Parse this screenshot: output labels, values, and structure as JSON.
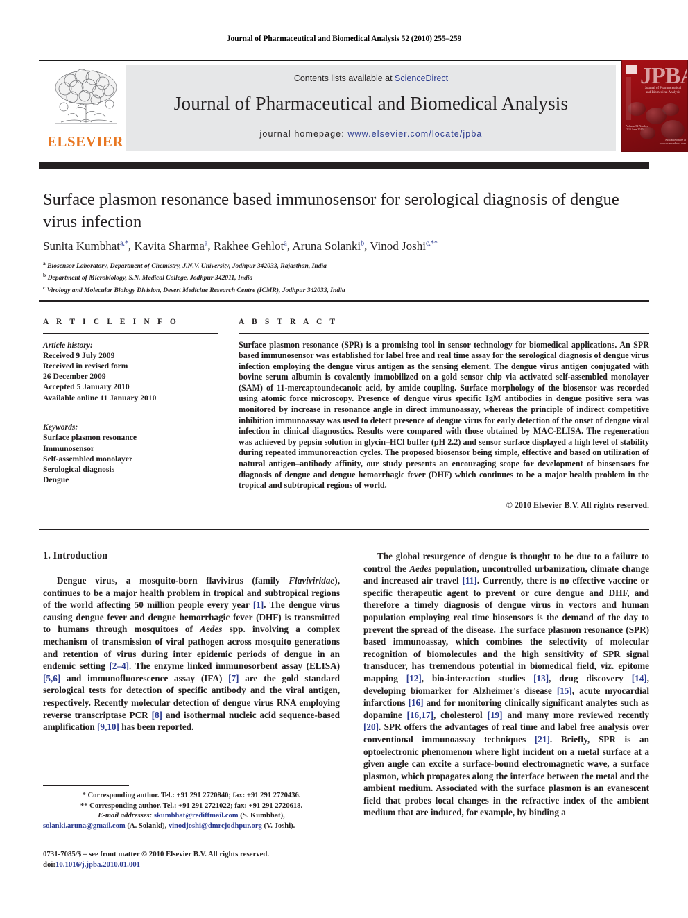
{
  "running_head": "Journal of Pharmaceutical and Biomedical Analysis 52 (2010) 255–259",
  "masthead": {
    "contents_text": "Contents lists available at ",
    "sciencedirect": "ScienceDirect",
    "journal_title": "Journal of Pharmaceutical and Biomedical Analysis",
    "homepage_label": "journal homepage: ",
    "homepage_url": "www.elsevier.com/locate/jpba",
    "publisher_wordmark": "ELSEVIER",
    "publisher_color": "#e87722",
    "link_color": "#2b3a8f",
    "banner_bg": "#e6e7e8",
    "cover": {
      "acronym": "JPBA",
      "subtitle": "Journal of Pharmaceutical and Biomedical Analysis",
      "bg_color": "#a81016",
      "footer_left": "Volume 52 Number 2 15 June 2010",
      "footer_right": "Available online at www.sciencedirect.com"
    }
  },
  "article": {
    "title": "Surface plasmon resonance based immunosensor for serological diagnosis of dengue virus infection",
    "authors": "Sunita Kumbhat<sup>a,</sup><sup>*</sup>, Kavita Sharma<sup>a</sup>, Rakhee Gehlot<sup>a</sup>, Aruna Solanki<sup>b</sup>, Vinod Joshi<sup>c,</sup><sup>**</sup>",
    "affiliations": [
      "<sup>a</sup> Biosensor Laboratory, Department of Chemistry, J.N.V. University, Jodhpur 342033, Rajasthan, India",
      "<sup>b</sup> Department of Microbiology, S.N. Medical College, Jodhpur 342011, India",
      "<sup>c</sup> Virology and Molecular Biology Division, Desert Medicine Research Centre (ICMR), Jodhpur 342033, India"
    ]
  },
  "article_info": {
    "heading": "A R T I C L E   I N F O",
    "history_label": "Article history:",
    "history": [
      "Received 9 July 2009",
      "Received in revised form",
      "26 December 2009",
      "Accepted 5 January 2010",
      "Available online 11 January 2010"
    ],
    "keywords_label": "Keywords:",
    "keywords": [
      "Surface plasmon resonance",
      "Immunosensor",
      "Self-assembled monolayer",
      "Serological diagnosis",
      "Dengue"
    ]
  },
  "abstract": {
    "heading": "A B S T R A C T",
    "text": "Surface plasmon resonance (SPR) is a promising tool in sensor technology for biomedical applications. An SPR based immunosensor was established for label free and real time assay for the serological diagnosis of dengue virus infection employing the dengue virus antigen as the sensing element. The dengue virus antigen conjugated with bovine serum albumin is covalently immobilized on a gold sensor chip via activated self-assembled monolayer (SAM) of 11-mercaptoundecanoic acid, by amide coupling. Surface morphology of the biosensor was recorded using atomic force microscopy. Presence of dengue virus specific IgM antibodies in dengue positive sera was monitored by increase in resonance angle in direct immunoassay, whereas the principle of indirect competitive inhibition immunoassay was used to detect presence of dengue virus for early detection of the onset of dengue viral infection in clinical diagnostics. Results were compared with those obtained by MAC-ELISA. The regeneration was achieved by pepsin solution in glycin–HCl buffer (pH 2.2) and sensor surface displayed a high level of stability during repeated immunoreaction cycles. The proposed biosensor being simple, effective and based on utilization of natural antigen–antibody affinity, our study presents an encouraging scope for development of biosensors for diagnosis of dengue and dengue hemorrhagic fever (DHF) which continues to be a major health problem in the tropical and subtropical regions of world.",
    "copyright": "© 2010 Elsevier B.V. All rights reserved."
  },
  "body": {
    "section_heading": "1.  Introduction",
    "left_paragraphs": [
      "Dengue virus, a mosquito-born flavivirus (family <em>Flaviviridae</em>), continues to be a major health problem in tropical and subtropical regions of the world affecting 50 million people every year <span class=\"ref\">[1]</span>. The dengue virus causing dengue fever and dengue hemorrhagic fever (DHF) is transmitted to humans through mosquitoes of <em>Aedes</em> spp. involving a complex mechanism of transmission of viral pathogen across mosquito generations and retention of virus during inter epidemic periods of dengue in an endemic setting <span class=\"ref\">[2–4]</span>. The enzyme linked immunosorbent assay (ELISA) <span class=\"ref\">[5,6]</span> and immunofluorescence assay (IFA) <span class=\"ref\">[7]</span> are the gold standard serological tests for detection of specific antibody and the viral antigen, respectively. Recently molecular detection of dengue virus RNA employing reverse transcriptase PCR <span class=\"ref\">[8]</span> and isothermal nucleic acid sequence-based amplification <span class=\"ref\">[9,10]</span> has been reported."
    ],
    "right_paragraphs": [
      "The global resurgence of dengue is thought to be due to a failure to control the <em>Aedes</em> population, uncontrolled urbanization, climate change and increased air travel <span class=\"ref\">[11]</span>. Currently, there is no effective vaccine or specific therapeutic agent to prevent or cure dengue and DHF, and therefore a timely diagnosis of dengue virus in vectors and human population employing real time biosensors is the demand of the day to prevent the spread of the disease. The surface plasmon resonance (SPR) based immunoassay, which combines the selectivity of molecular recognition of biomolecules and the high sensitivity of SPR signal transducer, has tremendous potential in biomedical field, viz. epitome mapping <span class=\"ref\">[12]</span>, bio-interaction studies <span class=\"ref\">[13]</span>, drug discovery <span class=\"ref\">[14]</span>, developing biomarker for Alzheimer's disease <span class=\"ref\">[15]</span>, acute myocardial infarctions <span class=\"ref\">[16]</span> and for monitoring clinically significant analytes such as dopamine <span class=\"ref\">[16,17]</span>, cholesterol <span class=\"ref\">[19]</span> and many more reviewed recently <span class=\"ref\">[20]</span>. SPR offers the advantages of real time and label free analysis over conventional immunoassay techniques <span class=\"ref\">[21]</span>. Briefly, SPR is an optoelectronic phenomenon where light incident on a metal surface at a given angle can excite a surface-bound electromagnetic wave, a surface plasmon, which propagates along the interface between the metal and the ambient medium. Associated with the surface plasmon is an evanescent field that probes local changes in the refractive index of the ambient medium that are induced, for example, by binding a"
    ]
  },
  "footnotes": {
    "corresponding_1": "* Corresponding author. Tel.: +91 291 2720840; fax: +91 291 2720436.",
    "corresponding_2": "** Corresponding author. Tel.: +91 291 2721022; fax: +91 291 2720618.",
    "email_label": "E-mail addresses:",
    "email_1": "skumbhat@rediffmail.com",
    "email_1_owner": "(S. Kumbhat),",
    "email_2": "solanki.aruna@gmail.com",
    "email_2_owner": "(A. Solanki),",
    "email_3": "vinodjoshi@dmrcjodhpur.org",
    "email_3_owner": "(V. Joshi)."
  },
  "imprint": {
    "line1": "0731-7085/$ – see front matter © 2010 Elsevier B.V. All rights reserved.",
    "doi_label": "doi:",
    "doi_value": "10.1016/j.jpba.2010.01.001"
  }
}
